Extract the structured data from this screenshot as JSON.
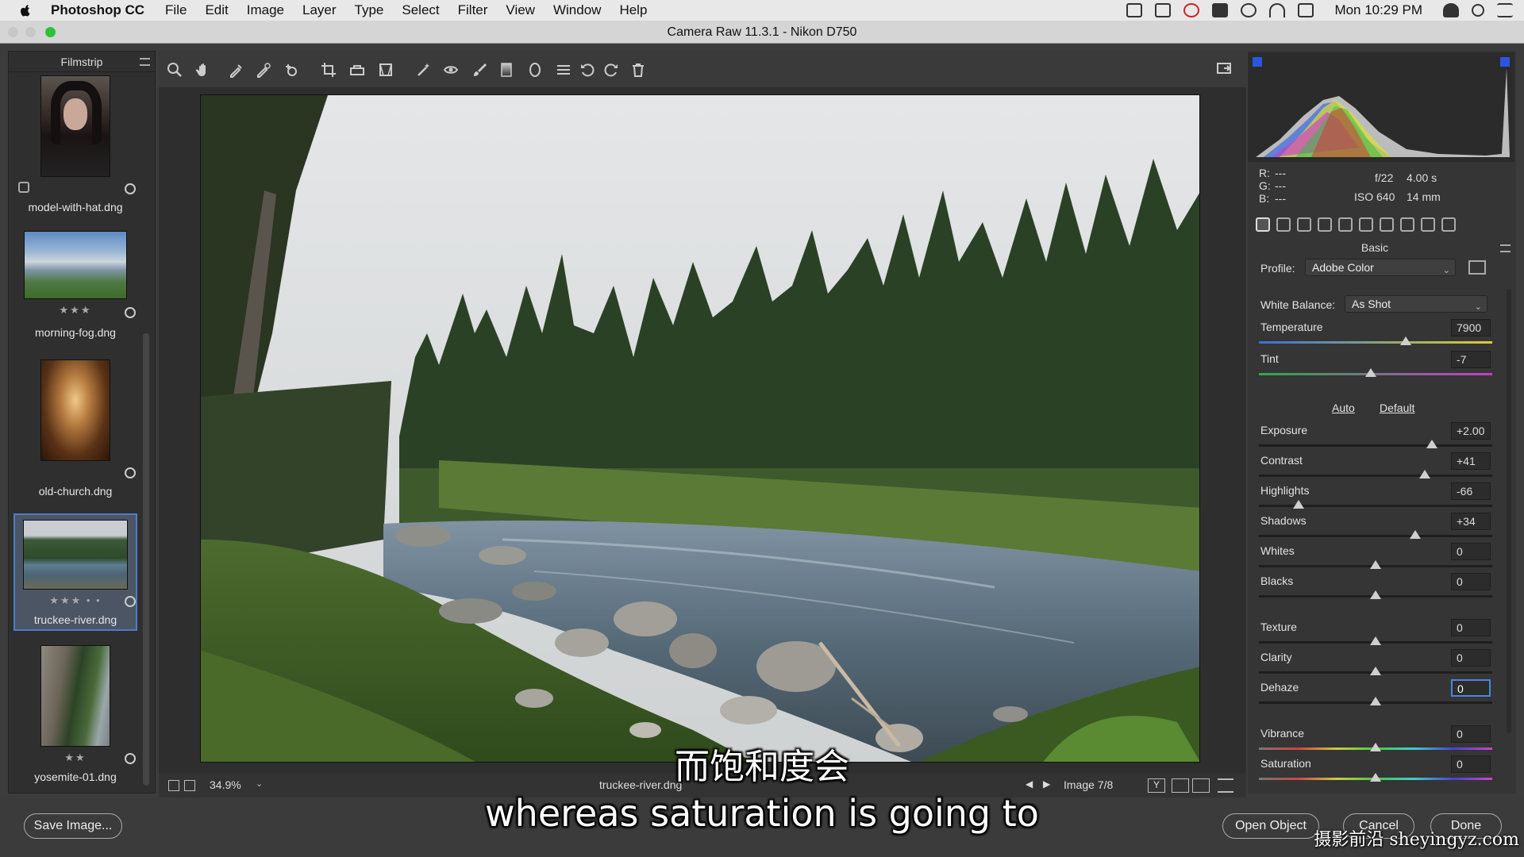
{
  "menubar": {
    "app_name": "Photoshop CC",
    "menus": [
      "File",
      "Edit",
      "Image",
      "Layer",
      "Type",
      "Select",
      "Filter",
      "View",
      "Window",
      "Help"
    ],
    "clock": "Mon 10:29 PM"
  },
  "window": {
    "title": "Camera Raw 11.3.1  -  Nikon D750"
  },
  "filmstrip": {
    "title": "Filmstrip",
    "items": [
      {
        "name": "model-with-hat.dng",
        "stars": "",
        "selected": false
      },
      {
        "name": "morning-fog.dng",
        "stars": "★★★",
        "selected": false
      },
      {
        "name": "old-church.dng",
        "stars": "",
        "selected": false
      },
      {
        "name": "truckee-river.dng",
        "stars": "★★★ • •",
        "selected": true
      },
      {
        "name": "yosemite-01.dng",
        "stars": "★★",
        "selected": false
      }
    ]
  },
  "toolbar": {
    "tools": [
      "zoom-tool",
      "hand-tool",
      "white-balance-tool",
      "color-sampler-tool",
      "targeted-adjustment-tool",
      "crop-tool",
      "straighten-tool",
      "transform-tool",
      "spot-removal-tool",
      "red-eye-tool",
      "adjustment-brush-tool",
      "graduated-filter-tool",
      "radial-filter-tool",
      "preferences",
      "rotate-ccw",
      "rotate-cw",
      "trash"
    ]
  },
  "statusbar": {
    "zoom": "34.9%",
    "filename": "truckee-river.dng",
    "image_counter": "Image 7/8"
  },
  "info": {
    "r_label": "R:",
    "g_label": "G:",
    "b_label": "B:",
    "r_val": "---",
    "g_val": "---",
    "b_val": "---",
    "aperture": "f/22",
    "shutter": "4.00 s",
    "iso": "ISO 640",
    "focal": "14 mm"
  },
  "basic": {
    "title": "Basic",
    "profile_label": "Profile:",
    "profile_value": "Adobe Color",
    "wb_label": "White Balance:",
    "wb_value": "As Shot",
    "auto_label": "Auto",
    "default_label": "Default",
    "sliders": [
      {
        "label": "Temperature",
        "value": "7900",
        "position": 0.63
      },
      {
        "label": "Tint",
        "value": "-7",
        "position": 0.48
      },
      {
        "label": "Exposure",
        "value": "+2.00",
        "position": 0.74
      },
      {
        "label": "Contrast",
        "value": "+41",
        "position": 0.71
      },
      {
        "label": "Highlights",
        "value": "-66",
        "position": 0.17
      },
      {
        "label": "Shadows",
        "value": "+34",
        "position": 0.67
      },
      {
        "label": "Whites",
        "value": "0",
        "position": 0.5
      },
      {
        "label": "Blacks",
        "value": "0",
        "position": 0.5
      },
      {
        "label": "Texture",
        "value": "0",
        "position": 0.5
      },
      {
        "label": "Clarity",
        "value": "0",
        "position": 0.5
      },
      {
        "label": "Dehaze",
        "value": "0",
        "position": 0.5
      },
      {
        "label": "Vibrance",
        "value": "0",
        "position": 0.5
      },
      {
        "label": "Saturation",
        "value": "0",
        "position": 0.5
      }
    ]
  },
  "buttons": {
    "save": "Save Image...",
    "open": "Open Object",
    "cancel": "Cancel",
    "done": "Done"
  },
  "subtitles": {
    "chinese": "而饱和度会",
    "english": "whereas saturation is going to"
  },
  "watermark": "摄影前沿 sheyingyz.com",
  "colors": {
    "accent": "#4d7bc8",
    "panel": "#353535"
  }
}
